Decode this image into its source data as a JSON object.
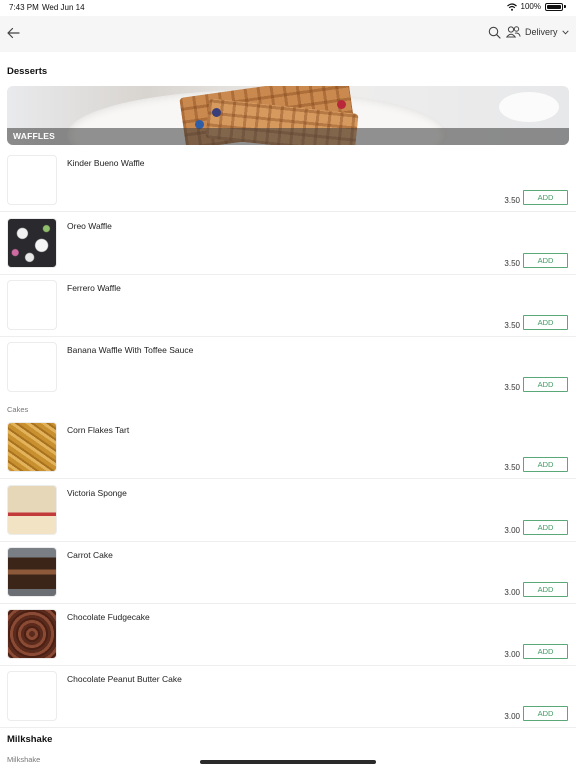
{
  "status_bar": {
    "time": "7:43 PM",
    "date": "Wed Jun 14",
    "battery": "100%"
  },
  "nav": {
    "delivery_label": "Delivery"
  },
  "colors": {
    "accent_green": "#3f9a62",
    "nav_background": "#f6f6f6"
  },
  "sections": {
    "desserts_title": "Desserts",
    "banner_caption": "WAFFLES",
    "cakes_label": "Cakes",
    "milkshake_title": "Milkshake",
    "milkshake_label": "Milkshake"
  },
  "items": [
    {
      "name": "Kinder Bueno Waffle",
      "price": "3.50",
      "add_label": "ADD",
      "image": "none"
    },
    {
      "name": "Oreo Waffle",
      "price": "3.50",
      "add_label": "ADD",
      "image": "oreo-waffle-photo"
    },
    {
      "name": "Ferrero Waffle",
      "price": "3.50",
      "add_label": "ADD",
      "image": "none"
    },
    {
      "name": "Banana Waffle With Toffee Sauce",
      "price": "3.50",
      "add_label": "ADD",
      "image": "none"
    },
    {
      "name": "Corn Flakes Tart",
      "price": "3.50",
      "add_label": "ADD",
      "image": "corn-flakes-tart-photo"
    },
    {
      "name": "Victoria Sponge",
      "price": "3.00",
      "add_label": "ADD",
      "image": "victoria-sponge-photo"
    },
    {
      "name": "Carrot Cake",
      "price": "3.00",
      "add_label": "ADD",
      "image": "carrot-cake-photo"
    },
    {
      "name": "Chocolate Fudgecake",
      "price": "3.00",
      "add_label": "ADD",
      "image": "chocolate-fudgecake-photo"
    },
    {
      "name": "Chocolate Peanut Butter Cake",
      "price": "3.00",
      "add_label": "ADD",
      "image": "none"
    }
  ]
}
